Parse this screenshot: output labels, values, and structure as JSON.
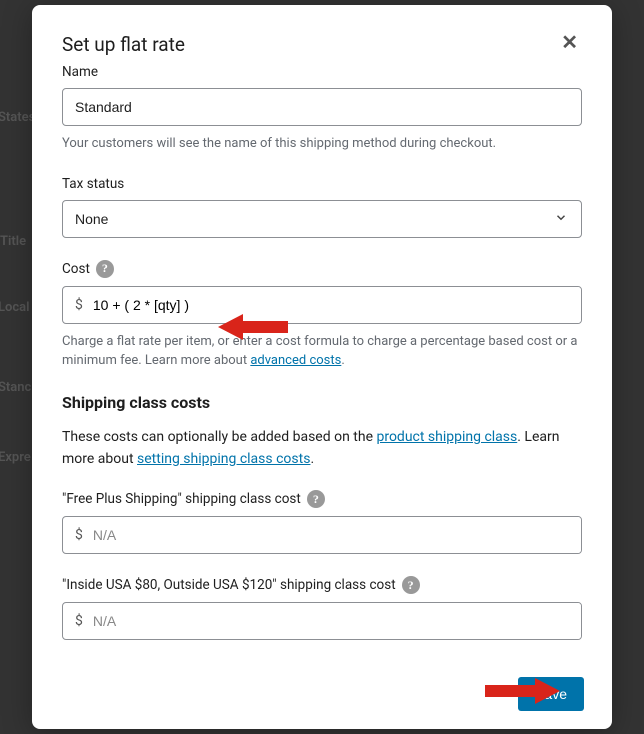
{
  "modal": {
    "title": "Set up flat rate",
    "close_symbol": "✕",
    "name": {
      "label": "Name",
      "value": "Standard",
      "help": "Your customers will see the name of this shipping method during checkout."
    },
    "tax_status": {
      "label": "Tax status",
      "value": "None"
    },
    "cost": {
      "label": "Cost",
      "currency": "$",
      "value": "10 + ( 2 * [qty] )",
      "help_prefix": "Charge a flat rate per item, or enter a cost formula to charge a percentage based cost or a minimum fee. Learn more about ",
      "help_link": "advanced costs",
      "help_suffix": "."
    },
    "shipping_class": {
      "title": "Shipping class costs",
      "desc_prefix": "These costs can optionally be added based on the ",
      "desc_link1": "product shipping class",
      "desc_mid": ". Learn more about ",
      "desc_link2": "setting shipping class costs",
      "desc_suffix": ".",
      "classes": [
        {
          "label": "\"Free Plus Shipping\" shipping class cost",
          "currency": "$",
          "placeholder": "N/A",
          "value": ""
        },
        {
          "label": "\"Inside USA $80, Outside USA $120\" shipping class cost",
          "currency": "$",
          "placeholder": "N/A",
          "value": ""
        }
      ]
    },
    "save_label": "Save"
  },
  "help_qmark": "?"
}
